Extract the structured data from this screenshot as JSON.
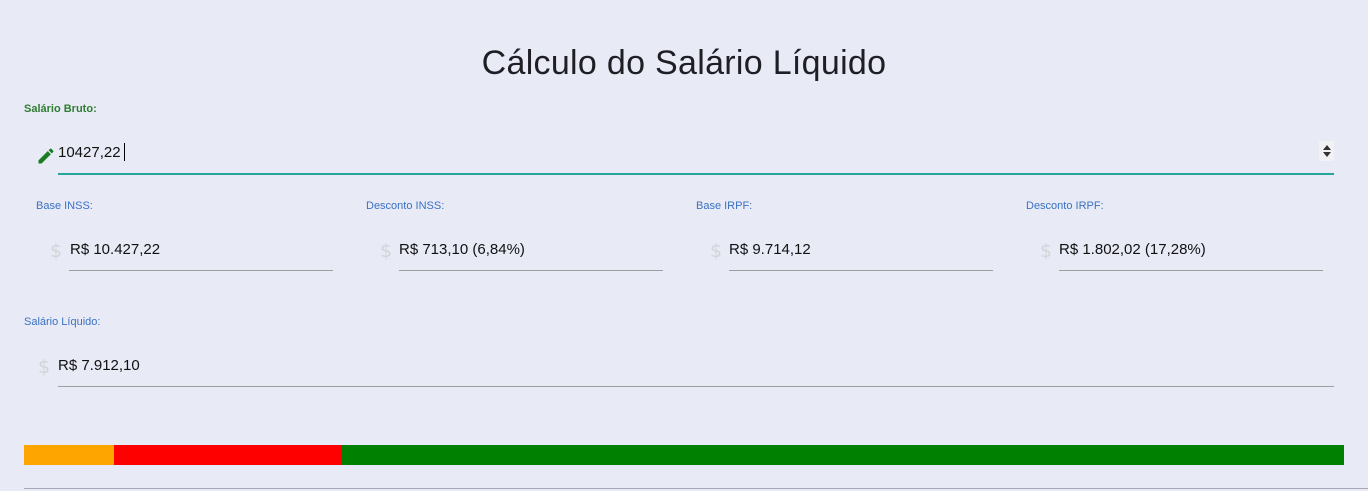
{
  "title": "Cálculo do Salário Líquido",
  "salario_bruto": {
    "label": "Salário Bruto:",
    "value": "10427,22",
    "icon": "pencil-icon"
  },
  "fields": [
    {
      "label": "Base INSS:",
      "value": "R$ 10.427,22",
      "icon": "dollar-icon"
    },
    {
      "label": "Desconto INSS:",
      "value": "R$ 713,10 (6,84%)",
      "icon": "dollar-icon"
    },
    {
      "label": "Base IRPF:",
      "value": "R$ 9.714,12",
      "icon": "dollar-icon"
    },
    {
      "label": "Desconto IRPF:",
      "value": "R$ 1.802,02 (17,28%)",
      "icon": "dollar-icon"
    }
  ],
  "salario_liquido": {
    "label": "Salário Líquido:",
    "value": "R$ 7.912,10",
    "icon": "dollar-icon"
  },
  "distribution_bar": [
    {
      "name": "desconto-inss",
      "percent": 6.84,
      "color": "#ffa500"
    },
    {
      "name": "desconto-irpf",
      "percent": 17.28,
      "color": "#ff0000"
    },
    {
      "name": "salario-liquido",
      "percent": 75.88,
      "color": "#008000"
    }
  ],
  "colors": {
    "background": "#e8eaf6",
    "label_blue": "#3a72c4",
    "label_green": "#2e7d32",
    "active_underline": "#26a69a"
  }
}
